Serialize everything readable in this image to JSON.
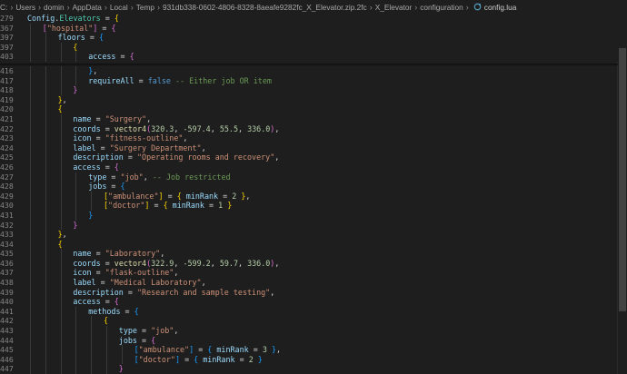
{
  "breadcrumb": {
    "items": [
      "C:",
      "Users",
      "domin",
      "AppData",
      "Local",
      "Temp",
      "931db338-0602-4806-8328-8aeafe9282fc_X_Elevator.zip.2fc",
      "X_Elevator",
      "configuration"
    ],
    "file": "config.lua"
  },
  "colors": {
    "background": "#1e1e1e",
    "variable": "#9cdcfe",
    "entity": "#4ec9b0",
    "string": "#ce9178",
    "number": "#b5cea8",
    "keyword": "#569cd6",
    "function": "#dcdcaa",
    "comment": "#6a9955",
    "bracket_level_1": "#ffd700",
    "bracket_level_2": "#da70d6",
    "bracket_level_3": "#179fff",
    "file_icon": "#519aba"
  },
  "editor": {
    "sticky_lines": [
      {
        "num": "279",
        "indent": 0,
        "tokens": [
          [
            "var",
            "Config"
          ],
          [
            "op",
            "."
          ],
          [
            "ent",
            "Elevators"
          ],
          [
            "op",
            " = "
          ],
          [
            "b1",
            "{"
          ]
        ]
      },
      {
        "num": "367",
        "indent": 1,
        "tokens": [
          [
            "b2",
            "["
          ],
          [
            "str",
            "\"hospital\""
          ],
          [
            "b2",
            "]"
          ],
          [
            "op",
            " = "
          ],
          [
            "b2",
            "{"
          ]
        ]
      },
      {
        "num": "397",
        "indent": 2,
        "tokens": [
          [
            "var",
            "floors"
          ],
          [
            "op",
            " = "
          ],
          [
            "b3",
            "{"
          ]
        ]
      },
      {
        "num": "397",
        "indent": 3,
        "tokens": [
          [
            "b1",
            "{"
          ]
        ]
      },
      {
        "num": "403",
        "indent": 4,
        "tokens": [
          [
            "var",
            "access"
          ],
          [
            "op",
            " = "
          ],
          [
            "b2",
            "{"
          ]
        ]
      }
    ],
    "lines": [
      {
        "num": "416",
        "indent": 4,
        "tokens": [
          [
            "b3",
            "}"
          ],
          [
            "op",
            ","
          ]
        ]
      },
      {
        "num": "417",
        "indent": 4,
        "tokens": [
          [
            "var",
            "requireAll"
          ],
          [
            "op",
            " = "
          ],
          [
            "kw",
            "false"
          ],
          [
            "op",
            " "
          ],
          [
            "cmt",
            "-- Either job OR item"
          ]
        ]
      },
      {
        "num": "418",
        "indent": 3,
        "tokens": [
          [
            "b2",
            "}"
          ]
        ]
      },
      {
        "num": "419",
        "indent": 2,
        "tokens": [
          [
            "b1",
            "}"
          ],
          [
            "op",
            ","
          ]
        ]
      },
      {
        "num": "420",
        "indent": 2,
        "tokens": [
          [
            "b1",
            "{"
          ]
        ]
      },
      {
        "num": "421",
        "indent": 3,
        "tokens": [
          [
            "var",
            "name"
          ],
          [
            "op",
            " = "
          ],
          [
            "str",
            "\"Surgery\""
          ],
          [
            "op",
            ","
          ]
        ]
      },
      {
        "num": "422",
        "indent": 3,
        "tokens": [
          [
            "var",
            "coords"
          ],
          [
            "op",
            " = "
          ],
          [
            "fn",
            "vector4"
          ],
          [
            "b2",
            "("
          ],
          [
            "num",
            "320.3"
          ],
          [
            "op",
            ", "
          ],
          [
            "num",
            "-597.4"
          ],
          [
            "op",
            ", "
          ],
          [
            "num",
            "55.5"
          ],
          [
            "op",
            ", "
          ],
          [
            "num",
            "336.0"
          ],
          [
            "b2",
            ")"
          ],
          [
            "op",
            ","
          ]
        ]
      },
      {
        "num": "423",
        "indent": 3,
        "tokens": [
          [
            "var",
            "icon"
          ],
          [
            "op",
            " = "
          ],
          [
            "str",
            "\"fitness-outline\""
          ],
          [
            "op",
            ","
          ]
        ]
      },
      {
        "num": "424",
        "indent": 3,
        "tokens": [
          [
            "var",
            "label"
          ],
          [
            "op",
            " = "
          ],
          [
            "str",
            "\"Surgery Department\""
          ],
          [
            "op",
            ","
          ]
        ]
      },
      {
        "num": "425",
        "indent": 3,
        "tokens": [
          [
            "var",
            "description"
          ],
          [
            "op",
            " = "
          ],
          [
            "str",
            "\"Operating rooms and recovery\""
          ],
          [
            "op",
            ","
          ]
        ]
      },
      {
        "num": "426",
        "indent": 3,
        "tokens": [
          [
            "var",
            "access"
          ],
          [
            "op",
            " = "
          ],
          [
            "b2",
            "{"
          ]
        ]
      },
      {
        "num": "427",
        "indent": 4,
        "tokens": [
          [
            "var",
            "type"
          ],
          [
            "op",
            " = "
          ],
          [
            "str",
            "\"job\""
          ],
          [
            "op",
            ", "
          ],
          [
            "cmt",
            "-- Job restricted"
          ]
        ]
      },
      {
        "num": "428",
        "indent": 4,
        "tokens": [
          [
            "var",
            "jobs"
          ],
          [
            "op",
            " = "
          ],
          [
            "b3",
            "{"
          ]
        ]
      },
      {
        "num": "429",
        "indent": 5,
        "tokens": [
          [
            "b1",
            "["
          ],
          [
            "str",
            "\"ambulance\""
          ],
          [
            "b1",
            "]"
          ],
          [
            "op",
            " = "
          ],
          [
            "b1",
            "{"
          ],
          [
            "op",
            " "
          ],
          [
            "var",
            "minRank"
          ],
          [
            "op",
            " = "
          ],
          [
            "num",
            "2"
          ],
          [
            "op",
            " "
          ],
          [
            "b1",
            "}"
          ],
          [
            "op",
            ","
          ]
        ]
      },
      {
        "num": "430",
        "indent": 5,
        "tokens": [
          [
            "b1",
            "["
          ],
          [
            "str",
            "\"doctor\""
          ],
          [
            "b1",
            "]"
          ],
          [
            "op",
            " = "
          ],
          [
            "b1",
            "{"
          ],
          [
            "op",
            " "
          ],
          [
            "var",
            "minRank"
          ],
          [
            "op",
            " = "
          ],
          [
            "num",
            "1"
          ],
          [
            "op",
            " "
          ],
          [
            "b1",
            "}"
          ]
        ]
      },
      {
        "num": "431",
        "indent": 4,
        "tokens": [
          [
            "b3",
            "}"
          ]
        ]
      },
      {
        "num": "432",
        "indent": 3,
        "tokens": [
          [
            "b2",
            "}"
          ]
        ]
      },
      {
        "num": "433",
        "indent": 2,
        "tokens": [
          [
            "b1",
            "}"
          ],
          [
            "op",
            ","
          ]
        ]
      },
      {
        "num": "434",
        "indent": 2,
        "tokens": [
          [
            "b1",
            "{"
          ]
        ]
      },
      {
        "num": "435",
        "indent": 3,
        "tokens": [
          [
            "var",
            "name"
          ],
          [
            "op",
            " = "
          ],
          [
            "str",
            "\"Laboratory\""
          ],
          [
            "op",
            ","
          ]
        ]
      },
      {
        "num": "436",
        "indent": 3,
        "tokens": [
          [
            "var",
            "coords"
          ],
          [
            "op",
            " = "
          ],
          [
            "fn",
            "vector4"
          ],
          [
            "b2",
            "("
          ],
          [
            "num",
            "322.9"
          ],
          [
            "op",
            ", "
          ],
          [
            "num",
            "-599.2"
          ],
          [
            "op",
            ", "
          ],
          [
            "num",
            "59.7"
          ],
          [
            "op",
            ", "
          ],
          [
            "num",
            "336.0"
          ],
          [
            "b2",
            ")"
          ],
          [
            "op",
            ","
          ]
        ]
      },
      {
        "num": "437",
        "indent": 3,
        "tokens": [
          [
            "var",
            "icon"
          ],
          [
            "op",
            " = "
          ],
          [
            "str",
            "\"flask-outline\""
          ],
          [
            "op",
            ","
          ]
        ]
      },
      {
        "num": "438",
        "indent": 3,
        "tokens": [
          [
            "var",
            "label"
          ],
          [
            "op",
            " = "
          ],
          [
            "str",
            "\"Medical Laboratory\""
          ],
          [
            "op",
            ","
          ]
        ]
      },
      {
        "num": "439",
        "indent": 3,
        "tokens": [
          [
            "var",
            "description"
          ],
          [
            "op",
            " = "
          ],
          [
            "str",
            "\"Research and sample testing\""
          ],
          [
            "op",
            ","
          ]
        ]
      },
      {
        "num": "440",
        "indent": 3,
        "tokens": [
          [
            "var",
            "access"
          ],
          [
            "op",
            " = "
          ],
          [
            "b2",
            "{"
          ]
        ]
      },
      {
        "num": "441",
        "indent": 4,
        "tokens": [
          [
            "var",
            "methods"
          ],
          [
            "op",
            " = "
          ],
          [
            "b3",
            "{"
          ]
        ]
      },
      {
        "num": "442",
        "indent": 5,
        "tokens": [
          [
            "b1",
            "{"
          ]
        ]
      },
      {
        "num": "443",
        "indent": 6,
        "tokens": [
          [
            "var",
            "type"
          ],
          [
            "op",
            " = "
          ],
          [
            "str",
            "\"job\""
          ],
          [
            "op",
            ","
          ]
        ]
      },
      {
        "num": "444",
        "indent": 6,
        "tokens": [
          [
            "var",
            "jobs"
          ],
          [
            "op",
            " = "
          ],
          [
            "b2",
            "{"
          ]
        ]
      },
      {
        "num": "445",
        "indent": 7,
        "tokens": [
          [
            "b3",
            "["
          ],
          [
            "str",
            "\"ambulance\""
          ],
          [
            "b3",
            "]"
          ],
          [
            "op",
            " = "
          ],
          [
            "b3",
            "{"
          ],
          [
            "op",
            " "
          ],
          [
            "var",
            "minRank"
          ],
          [
            "op",
            " = "
          ],
          [
            "num",
            "3"
          ],
          [
            "op",
            " "
          ],
          [
            "b3",
            "}"
          ],
          [
            "op",
            ","
          ]
        ]
      },
      {
        "num": "446",
        "indent": 7,
        "tokens": [
          [
            "b3",
            "["
          ],
          [
            "str",
            "\"doctor\""
          ],
          [
            "b3",
            "]"
          ],
          [
            "op",
            " = "
          ],
          [
            "b3",
            "{"
          ],
          [
            "op",
            " "
          ],
          [
            "var",
            "minRank"
          ],
          [
            "op",
            " = "
          ],
          [
            "num",
            "2"
          ],
          [
            "op",
            " "
          ],
          [
            "b3",
            "}"
          ]
        ]
      },
      {
        "num": "447",
        "indent": 6,
        "tokens": [
          [
            "b2",
            "}"
          ]
        ]
      }
    ]
  }
}
